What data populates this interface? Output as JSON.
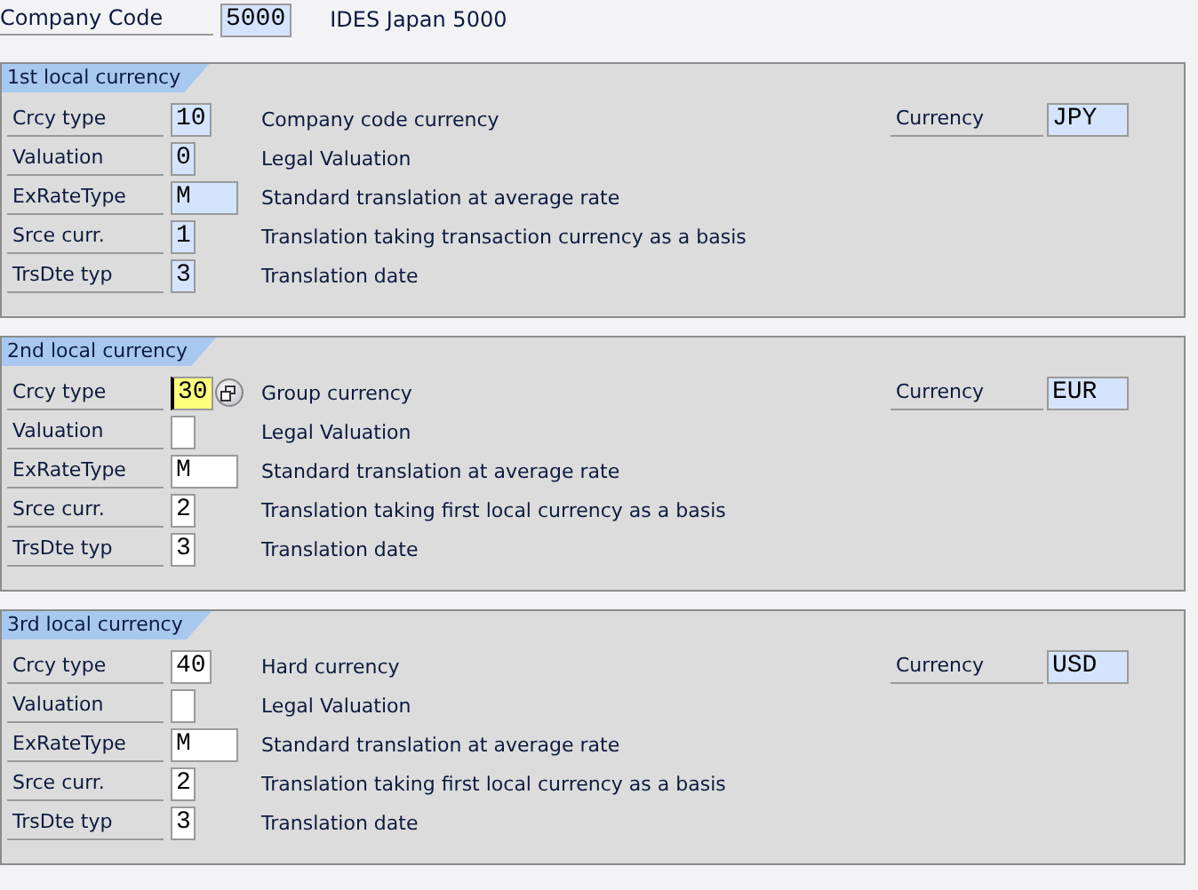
{
  "company": {
    "label": "Company Code",
    "field": {
      "value": "5000",
      "kind": "display"
    },
    "description": "IDES Japan 5000"
  },
  "sections": [
    {
      "title": "1st local currency",
      "currency": {
        "label": "Currency",
        "field": {
          "value": "JPY",
          "kind": "display"
        }
      },
      "rows": [
        {
          "label": "Crcy type",
          "field": {
            "value": "10",
            "kind": "display"
          },
          "description": "Company code currency"
        },
        {
          "label": "Valuation",
          "field": {
            "value": "0",
            "kind": "display"
          },
          "description": "Legal Valuation"
        },
        {
          "label": "ExRateType",
          "field": {
            "value": "M",
            "kind": "display"
          },
          "description": "Standard translation at average rate"
        },
        {
          "label": "Srce curr.",
          "field": {
            "value": "1",
            "kind": "display"
          },
          "description": "Translation taking transaction currency as a basis"
        },
        {
          "label": "TrsDte typ",
          "field": {
            "value": "3",
            "kind": "display"
          },
          "description": "Translation date"
        }
      ]
    },
    {
      "title": "2nd local currency",
      "currency": {
        "label": "Currency",
        "field": {
          "value": "EUR",
          "kind": "display"
        }
      },
      "rows": [
        {
          "label": "Crcy type",
          "field": {
            "value": "30",
            "kind": "focused"
          },
          "description": "Group currency"
        },
        {
          "label": "Valuation",
          "field": {
            "kind": "input"
          },
          "description": "Legal Valuation"
        },
        {
          "label": "ExRateType",
          "field": {
            "value": "M",
            "kind": "input"
          },
          "description": "Standard translation at average rate"
        },
        {
          "label": "Srce curr.",
          "field": {
            "value": "2",
            "kind": "input"
          },
          "description": "Translation taking first local currency as a basis"
        },
        {
          "label": "TrsDte typ",
          "field": {
            "value": "3",
            "kind": "input"
          },
          "description": "Translation date"
        }
      ]
    },
    {
      "title": "3rd local currency",
      "currency": {
        "label": "Currency",
        "field": {
          "value": "USD",
          "kind": "display"
        }
      },
      "rows": [
        {
          "label": "Crcy type",
          "field": {
            "value": "40",
            "kind": "input"
          },
          "description": "Hard currency"
        },
        {
          "label": "Valuation",
          "field": {
            "kind": "input"
          },
          "description": "Legal Valuation"
        },
        {
          "label": "ExRateType",
          "field": {
            "value": "M",
            "kind": "input"
          },
          "description": "Standard translation at average rate"
        },
        {
          "label": "Srce curr.",
          "field": {
            "value": "2",
            "kind": "input"
          },
          "description": "Translation taking first local currency as a basis"
        },
        {
          "label": "TrsDte typ",
          "field": {
            "value": "3",
            "kind": "input"
          },
          "description": "Translation date"
        }
      ]
    }
  ]
}
